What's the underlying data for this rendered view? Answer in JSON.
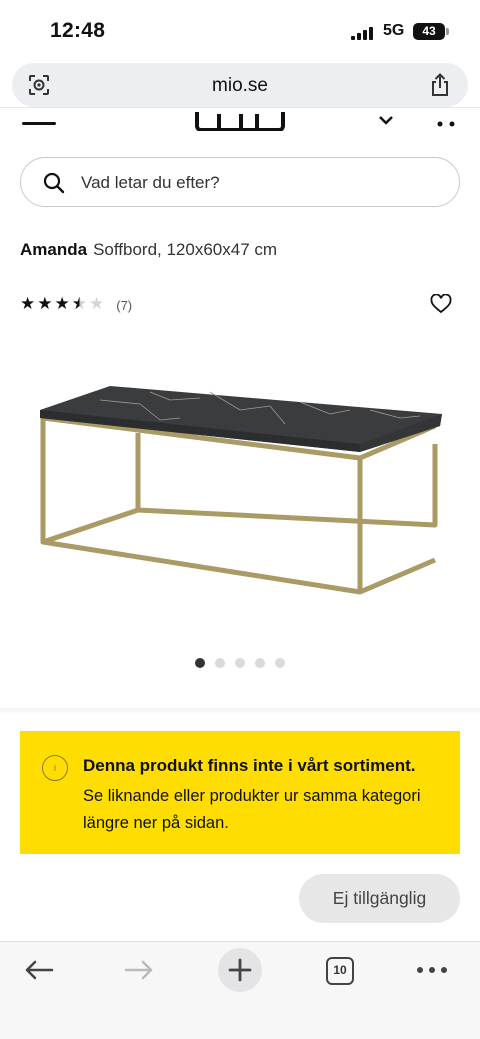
{
  "status_bar": {
    "time": "12:48",
    "network": "5G",
    "battery": "43"
  },
  "browser": {
    "url": "mio.se",
    "tab_count": "10"
  },
  "search": {
    "placeholder": "Vad letar du efter?"
  },
  "product": {
    "brand": "Amanda",
    "subtitle": "Soffbord, 120x60x47 cm",
    "rating": 3.5,
    "review_count": "(7)",
    "image_count": 5,
    "active_image": 1
  },
  "notice": {
    "icon": "info-icon",
    "title": "Denna produkt finns inte i vårt sortiment.",
    "body": "Se liknande eller produkter ur samma kategori längre ner på sidan."
  },
  "actions": {
    "unavailable_label": "Ej tillgänglig"
  },
  "colors": {
    "notice_bg": "#ffdd00",
    "brass_frame": "#a99a66",
    "marble": "#3a3c3e"
  }
}
